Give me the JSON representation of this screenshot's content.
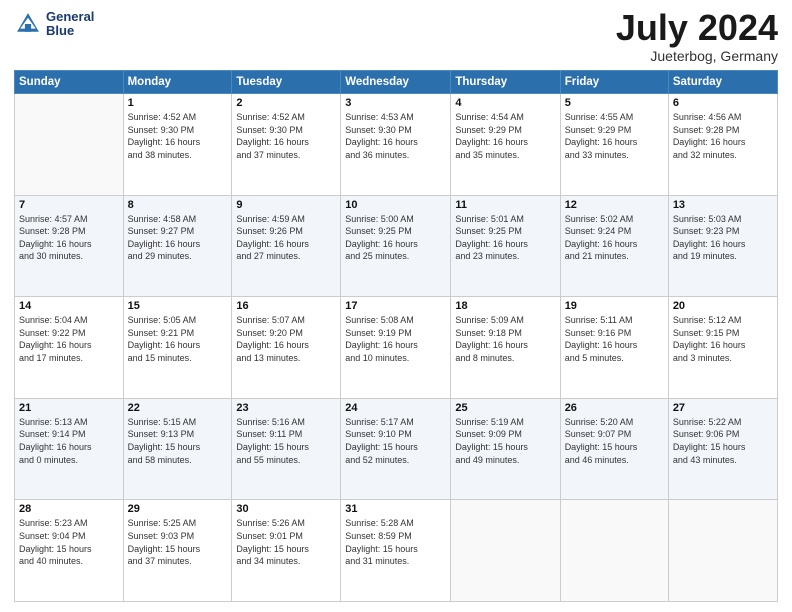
{
  "header": {
    "logo_line1": "General",
    "logo_line2": "Blue",
    "month_title": "July 2024",
    "location": "Jueterbog, Germany"
  },
  "days_of_week": [
    "Sunday",
    "Monday",
    "Tuesday",
    "Wednesday",
    "Thursday",
    "Friday",
    "Saturday"
  ],
  "weeks": [
    [
      {
        "day": "",
        "info": ""
      },
      {
        "day": "1",
        "info": "Sunrise: 4:52 AM\nSunset: 9:30 PM\nDaylight: 16 hours\nand 38 minutes."
      },
      {
        "day": "2",
        "info": "Sunrise: 4:52 AM\nSunset: 9:30 PM\nDaylight: 16 hours\nand 37 minutes."
      },
      {
        "day": "3",
        "info": "Sunrise: 4:53 AM\nSunset: 9:30 PM\nDaylight: 16 hours\nand 36 minutes."
      },
      {
        "day": "4",
        "info": "Sunrise: 4:54 AM\nSunset: 9:29 PM\nDaylight: 16 hours\nand 35 minutes."
      },
      {
        "day": "5",
        "info": "Sunrise: 4:55 AM\nSunset: 9:29 PM\nDaylight: 16 hours\nand 33 minutes."
      },
      {
        "day": "6",
        "info": "Sunrise: 4:56 AM\nSunset: 9:28 PM\nDaylight: 16 hours\nand 32 minutes."
      }
    ],
    [
      {
        "day": "7",
        "info": "Sunrise: 4:57 AM\nSunset: 9:28 PM\nDaylight: 16 hours\nand 30 minutes."
      },
      {
        "day": "8",
        "info": "Sunrise: 4:58 AM\nSunset: 9:27 PM\nDaylight: 16 hours\nand 29 minutes."
      },
      {
        "day": "9",
        "info": "Sunrise: 4:59 AM\nSunset: 9:26 PM\nDaylight: 16 hours\nand 27 minutes."
      },
      {
        "day": "10",
        "info": "Sunrise: 5:00 AM\nSunset: 9:25 PM\nDaylight: 16 hours\nand 25 minutes."
      },
      {
        "day": "11",
        "info": "Sunrise: 5:01 AM\nSunset: 9:25 PM\nDaylight: 16 hours\nand 23 minutes."
      },
      {
        "day": "12",
        "info": "Sunrise: 5:02 AM\nSunset: 9:24 PM\nDaylight: 16 hours\nand 21 minutes."
      },
      {
        "day": "13",
        "info": "Sunrise: 5:03 AM\nSunset: 9:23 PM\nDaylight: 16 hours\nand 19 minutes."
      }
    ],
    [
      {
        "day": "14",
        "info": "Sunrise: 5:04 AM\nSunset: 9:22 PM\nDaylight: 16 hours\nand 17 minutes."
      },
      {
        "day": "15",
        "info": "Sunrise: 5:05 AM\nSunset: 9:21 PM\nDaylight: 16 hours\nand 15 minutes."
      },
      {
        "day": "16",
        "info": "Sunrise: 5:07 AM\nSunset: 9:20 PM\nDaylight: 16 hours\nand 13 minutes."
      },
      {
        "day": "17",
        "info": "Sunrise: 5:08 AM\nSunset: 9:19 PM\nDaylight: 16 hours\nand 10 minutes."
      },
      {
        "day": "18",
        "info": "Sunrise: 5:09 AM\nSunset: 9:18 PM\nDaylight: 16 hours\nand 8 minutes."
      },
      {
        "day": "19",
        "info": "Sunrise: 5:11 AM\nSunset: 9:16 PM\nDaylight: 16 hours\nand 5 minutes."
      },
      {
        "day": "20",
        "info": "Sunrise: 5:12 AM\nSunset: 9:15 PM\nDaylight: 16 hours\nand 3 minutes."
      }
    ],
    [
      {
        "day": "21",
        "info": "Sunrise: 5:13 AM\nSunset: 9:14 PM\nDaylight: 16 hours\nand 0 minutes."
      },
      {
        "day": "22",
        "info": "Sunrise: 5:15 AM\nSunset: 9:13 PM\nDaylight: 15 hours\nand 58 minutes."
      },
      {
        "day": "23",
        "info": "Sunrise: 5:16 AM\nSunset: 9:11 PM\nDaylight: 15 hours\nand 55 minutes."
      },
      {
        "day": "24",
        "info": "Sunrise: 5:17 AM\nSunset: 9:10 PM\nDaylight: 15 hours\nand 52 minutes."
      },
      {
        "day": "25",
        "info": "Sunrise: 5:19 AM\nSunset: 9:09 PM\nDaylight: 15 hours\nand 49 minutes."
      },
      {
        "day": "26",
        "info": "Sunrise: 5:20 AM\nSunset: 9:07 PM\nDaylight: 15 hours\nand 46 minutes."
      },
      {
        "day": "27",
        "info": "Sunrise: 5:22 AM\nSunset: 9:06 PM\nDaylight: 15 hours\nand 43 minutes."
      }
    ],
    [
      {
        "day": "28",
        "info": "Sunrise: 5:23 AM\nSunset: 9:04 PM\nDaylight: 15 hours\nand 40 minutes."
      },
      {
        "day": "29",
        "info": "Sunrise: 5:25 AM\nSunset: 9:03 PM\nDaylight: 15 hours\nand 37 minutes."
      },
      {
        "day": "30",
        "info": "Sunrise: 5:26 AM\nSunset: 9:01 PM\nDaylight: 15 hours\nand 34 minutes."
      },
      {
        "day": "31",
        "info": "Sunrise: 5:28 AM\nSunset: 8:59 PM\nDaylight: 15 hours\nand 31 minutes."
      },
      {
        "day": "",
        "info": ""
      },
      {
        "day": "",
        "info": ""
      },
      {
        "day": "",
        "info": ""
      }
    ]
  ]
}
